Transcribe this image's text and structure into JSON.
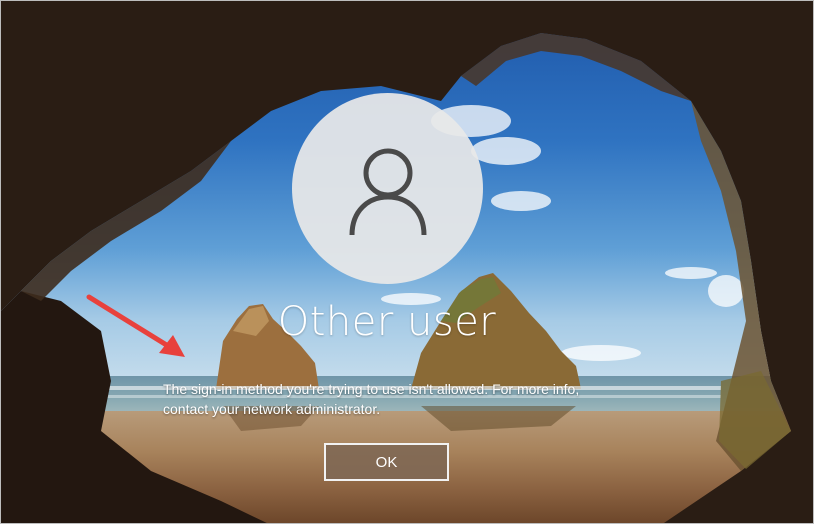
{
  "user": {
    "name": "Other user",
    "avatar_icon": "person-icon"
  },
  "message": {
    "line1": "The sign-in method you're trying to use isn't allowed. For more info,",
    "line2": "contact your network administrator."
  },
  "buttons": {
    "ok_label": "OK"
  },
  "annotation": {
    "arrow_icon": "red-arrow-icon",
    "color": "#e8413c"
  },
  "colors": {
    "button_bg": "#806854",
    "text": "#ffffff"
  }
}
